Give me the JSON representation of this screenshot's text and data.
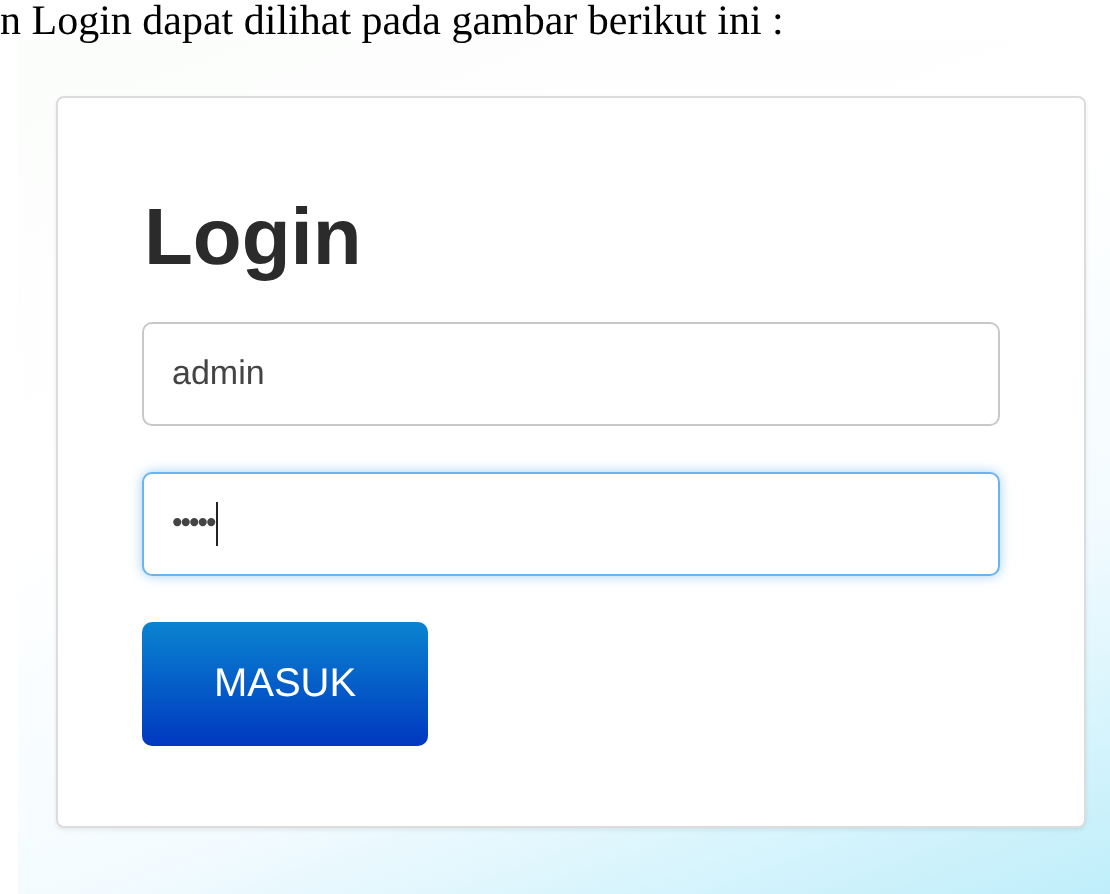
{
  "caption": "n Login dapat dilihat pada gambar berikut ini :",
  "login_form": {
    "title": "Login",
    "fields": [
      {
        "kind": "text",
        "value": "admin",
        "focused": false
      },
      {
        "kind": "password",
        "value": "•••••",
        "focused": true
      }
    ],
    "button": "MASUK"
  }
}
